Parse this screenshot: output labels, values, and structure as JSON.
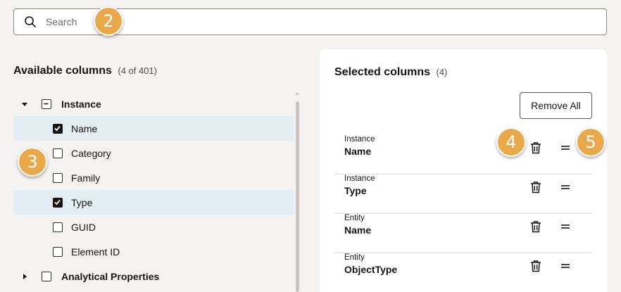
{
  "search": {
    "placeholder": "Search",
    "value": ""
  },
  "available": {
    "title": "Available columns",
    "count": "(4 of 401)",
    "tree": [
      {
        "label": "Instance",
        "type": "parent",
        "expanded": true,
        "checkbox": "indeterminate"
      },
      {
        "label": "Name",
        "type": "child",
        "checked": true,
        "selected": true
      },
      {
        "label": "Category",
        "type": "child",
        "checked": false,
        "selected": false
      },
      {
        "label": "Family",
        "type": "child",
        "checked": false,
        "selected": false
      },
      {
        "label": "Type",
        "type": "child",
        "checked": true,
        "selected": true
      },
      {
        "label": "GUID",
        "type": "child",
        "checked": false,
        "selected": false
      },
      {
        "label": "Element ID",
        "type": "child",
        "checked": false,
        "selected": false
      },
      {
        "label": "Analytical Properties",
        "type": "parent",
        "expanded": false,
        "checkbox": "unchecked"
      }
    ]
  },
  "selected": {
    "title": "Selected columns",
    "count": "(4)",
    "remove_all_label": "Remove All",
    "items": [
      {
        "group": "Instance",
        "name": "Name"
      },
      {
        "group": "Instance",
        "name": "Type"
      },
      {
        "group": "Entity",
        "name": "Name"
      },
      {
        "group": "Entity",
        "name": "ObjectType"
      }
    ]
  },
  "callouts": [
    "2",
    "3",
    "4",
    "5"
  ],
  "icons": {
    "search": "search-icon",
    "trash": "trash-icon",
    "drag": "drag-handle-icon",
    "caret_down": "caret-down-icon",
    "caret_right": "caret-right-icon"
  },
  "colors": {
    "background": "#f4f3f1",
    "selected_row": "#e4edf2",
    "callout": "#e9a94a",
    "panel": "#ffffff"
  }
}
